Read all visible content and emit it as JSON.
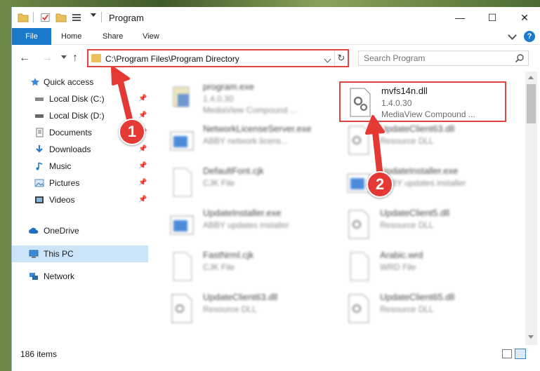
{
  "window": {
    "title": "Program",
    "minimize": "—",
    "maximize": "☐",
    "close": "✕"
  },
  "ribbon": {
    "tabs": [
      {
        "label": "File"
      },
      {
        "label": "Home"
      },
      {
        "label": "Share"
      },
      {
        "label": "View"
      }
    ],
    "help": "?"
  },
  "address": {
    "path": "C:\\Program Files\\Program Directory",
    "refresh": "↻"
  },
  "search": {
    "placeholder": "Search Program"
  },
  "nav_pane": {
    "items": [
      {
        "label": "Quick access",
        "icon": "star-icon",
        "pinned": false
      },
      {
        "label": "Local Disk (C:)",
        "icon": "drive-icon",
        "pinned": true
      },
      {
        "label": "Local Disk (D:)",
        "icon": "drive-icon",
        "pinned": true
      },
      {
        "label": "Documents",
        "icon": "documents-icon",
        "pinned": true
      },
      {
        "label": "Downloads",
        "icon": "download-icon",
        "pinned": true
      },
      {
        "label": "Music",
        "icon": "music-icon",
        "pinned": true
      },
      {
        "label": "Pictures",
        "icon": "pictures-icon",
        "pinned": true
      },
      {
        "label": "Videos",
        "icon": "videos-icon",
        "pinned": true
      },
      {
        "label": "OneDrive",
        "icon": "cloud-icon",
        "pinned": false
      },
      {
        "label": "This PC",
        "icon": "computer-icon",
        "pinned": false,
        "selected": true
      },
      {
        "label": "Network",
        "icon": "network-icon",
        "pinned": false
      }
    ],
    "pin_glyph": "📌"
  },
  "files": [
    {
      "name": "program.exe",
      "line1": "1.4.0.30",
      "line2": "MediaView Compound ...",
      "icon": "exe-icon"
    },
    {
      "name": "mvfs14n.dll",
      "line1": "1.4.0.30",
      "line2": "MediaView Compound ...",
      "icon": "dll-gear-icon",
      "highlighted": true
    },
    {
      "name": "NetworkLicenseServer.exe",
      "line1": "ABBY network licens...",
      "line2": "",
      "icon": "app-window-icon"
    },
    {
      "name": "UpdateClient63.dll",
      "line1": "Resource DLL",
      "line2": "",
      "icon": "dll-gear-icon"
    },
    {
      "name": "DefaultFont.cjk",
      "line1": "CJK File",
      "line2": "",
      "icon": "blank-file-icon"
    },
    {
      "name": "UpdateInstaller.exe",
      "line1": "ABBY updates installer",
      "line2": "",
      "icon": "app-window-icon"
    },
    {
      "name": "UpdateInstaller.exe",
      "line1": "ABBY updates installer",
      "line2": "",
      "icon": "app-window-icon"
    },
    {
      "name": "UpdateClient5.dll",
      "line1": "Resource DLL",
      "line2": "",
      "icon": "dll-gear-icon"
    },
    {
      "name": "FastNrml.cjk",
      "line1": "CJK File",
      "line2": "",
      "icon": "blank-file-icon"
    },
    {
      "name": "Arabic.wrd",
      "line1": "WRD File",
      "line2": "",
      "icon": "blank-file-icon"
    },
    {
      "name": "UpdateClient63.dll",
      "line1": "Resource DLL",
      "line2": "",
      "icon": "dll-gear-icon"
    },
    {
      "name": "UpdateClient65.dll",
      "line1": "Resource DLL",
      "line2": "",
      "icon": "dll-gear-icon"
    }
  ],
  "status": {
    "item_count": "186 items"
  },
  "annotations": {
    "callout_1": "1",
    "callout_2": "2",
    "color": "#e53935"
  }
}
